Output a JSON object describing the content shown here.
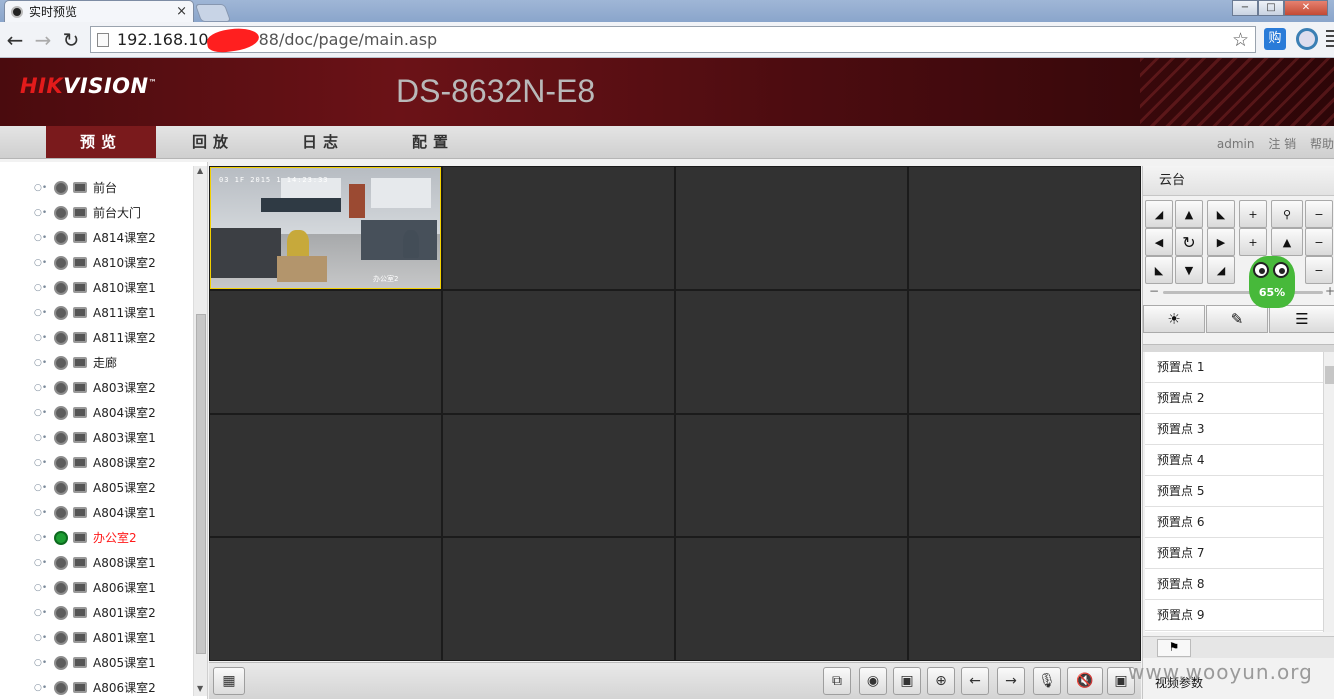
{
  "browser": {
    "tab_title": "实时预览",
    "tab_close": "×",
    "url_host": "192.168.10",
    "url_rest": "88/doc/page/main.asp",
    "window_controls": [
      "−",
      "□",
      "✕"
    ],
    "ext_label": "购"
  },
  "header": {
    "logo_hik": "HIK",
    "logo_vision": "VISION",
    "logo_tm": "™",
    "model": "DS-8632N-E8"
  },
  "menu": {
    "items": [
      "预览",
      "回放",
      "日志",
      "配置"
    ],
    "active_index": 0,
    "user": "admin",
    "logout": "注 销",
    "help": "帮助"
  },
  "channels": [
    {
      "label": "前台",
      "live": false
    },
    {
      "label": "前台大门",
      "live": false
    },
    {
      "label": "A814课室2",
      "live": false
    },
    {
      "label": "A810课室2",
      "live": false
    },
    {
      "label": "A810课室1",
      "live": false
    },
    {
      "label": "A811课室1",
      "live": false
    },
    {
      "label": "A811课室2",
      "live": false
    },
    {
      "label": "走廊",
      "live": false
    },
    {
      "label": "A803课室2",
      "live": false
    },
    {
      "label": "A804课室2",
      "live": false
    },
    {
      "label": "A803课室1",
      "live": false
    },
    {
      "label": "A808课室2",
      "live": false
    },
    {
      "label": "A805课室2",
      "live": false
    },
    {
      "label": "A804课室1",
      "live": false
    },
    {
      "label": "办公室2",
      "live": true
    },
    {
      "label": "A808课室1",
      "live": false
    },
    {
      "label": "A806课室1",
      "live": false
    },
    {
      "label": "A801课室2",
      "live": false
    },
    {
      "label": "A801课室1",
      "live": false
    },
    {
      "label": "A805课室1",
      "live": false
    },
    {
      "label": "A806课室2",
      "live": false
    }
  ],
  "video": {
    "osd_time": "03 1F 2015 1 14:23:33",
    "osd_name": "办公室2"
  },
  "ptz": {
    "title": "云台",
    "speed_level": 0.6,
    "presets": [
      "预置点 1",
      "预置点 2",
      "预置点 3",
      "预置点 4",
      "预置点 5",
      "预置点 6",
      "预置点 7",
      "预置点 8",
      "预置点 9"
    ],
    "video_params_label": "视频参数"
  },
  "mascot_percent": "65%",
  "watermark": "www.wooyun.org",
  "colors": {
    "brand_red": "#7a1a1c",
    "selected_tile_border": "#f2d000",
    "live_channel": "#ff1a1a"
  }
}
